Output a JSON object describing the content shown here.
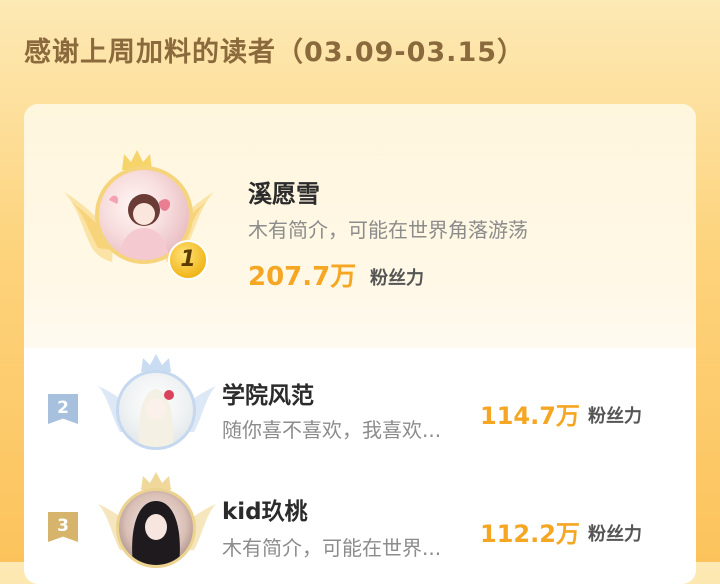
{
  "header": {
    "title": "感谢上周加料的读者（03.09-03.15）"
  },
  "readers": [
    {
      "rank": "1",
      "name": "溪愿雪",
      "bio": "木有简介，可能在世界角落游荡",
      "amount": "207.7万",
      "unit": "粉丝力"
    },
    {
      "rank": "2",
      "name": "学院风范",
      "bio": "随你喜不喜欢，我喜欢...",
      "amount": "114.7万",
      "unit": "粉丝力"
    },
    {
      "rank": "3",
      "name": "kid玖桃",
      "bio": "木有简介，可能在世界...",
      "amount": "112.2万",
      "unit": "粉丝力"
    }
  ],
  "colors": {
    "accent": "#f5a623",
    "title": "#8a6a3c",
    "rank2": "#8fb0d8",
    "rank3": "#d9b56b",
    "gold": "#f2c34a"
  },
  "icons": [
    "crown-icon",
    "wings-icon",
    "rank-badge-icon"
  ]
}
